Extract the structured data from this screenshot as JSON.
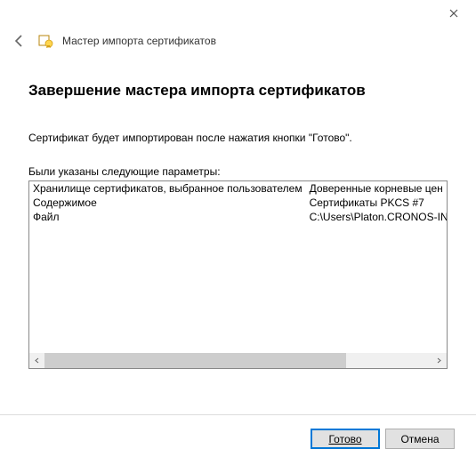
{
  "window": {
    "close_tooltip": "Close"
  },
  "header": {
    "title": "Мастер импорта сертификатов"
  },
  "content": {
    "heading": "Завершение мастера импорта сертификатов",
    "description": "Сертификат будет импортирован после нажатия кнопки \"Готово\".",
    "params_label": "Были указаны следующие параметры:",
    "rows": [
      {
        "name": "Хранилище сертификатов, выбранное пользователем",
        "value": "Доверенные корневые цен"
      },
      {
        "name": "Содержимое",
        "value": "Сертификаты PKCS #7"
      },
      {
        "name": "Файл",
        "value": "C:\\Users\\Platon.CRONOS-INF"
      }
    ]
  },
  "buttons": {
    "finish": "Готово",
    "cancel": "Отмена"
  }
}
